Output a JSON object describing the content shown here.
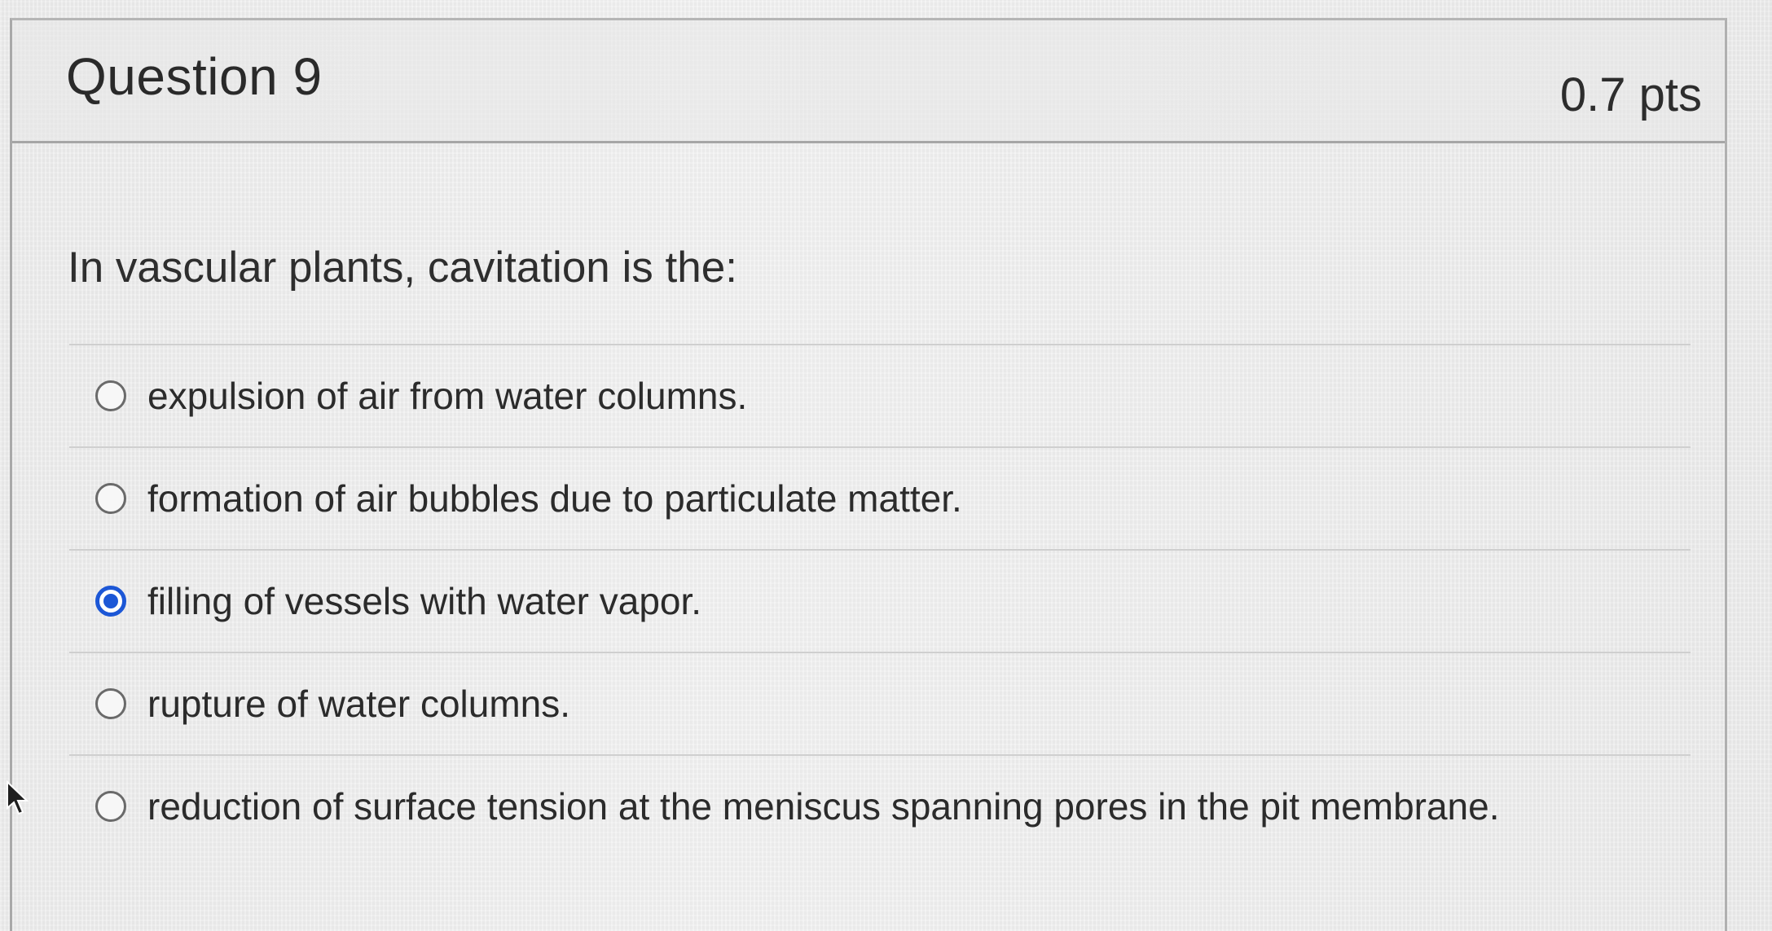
{
  "question": {
    "title": "Question 9",
    "points": "0.7 pts",
    "text": "In vascular plants, cavitation is the:"
  },
  "answers": [
    {
      "label": "expulsion of air from water columns.",
      "selected": false
    },
    {
      "label": "formation of air bubbles due to particulate matter.",
      "selected": false
    },
    {
      "label": "filling of vessels with water vapor.",
      "selected": true
    },
    {
      "label": "rupture of water columns.",
      "selected": false
    },
    {
      "label": "reduction of surface tension at the meniscus spanning pores in the pit membrane.",
      "selected": false
    }
  ],
  "colors": {
    "selected_radio": "#1c57d6",
    "text": "#2b2b2b",
    "divider": "#cfcfcf"
  },
  "icons": {
    "cursor": "mouse-pointer-icon"
  }
}
